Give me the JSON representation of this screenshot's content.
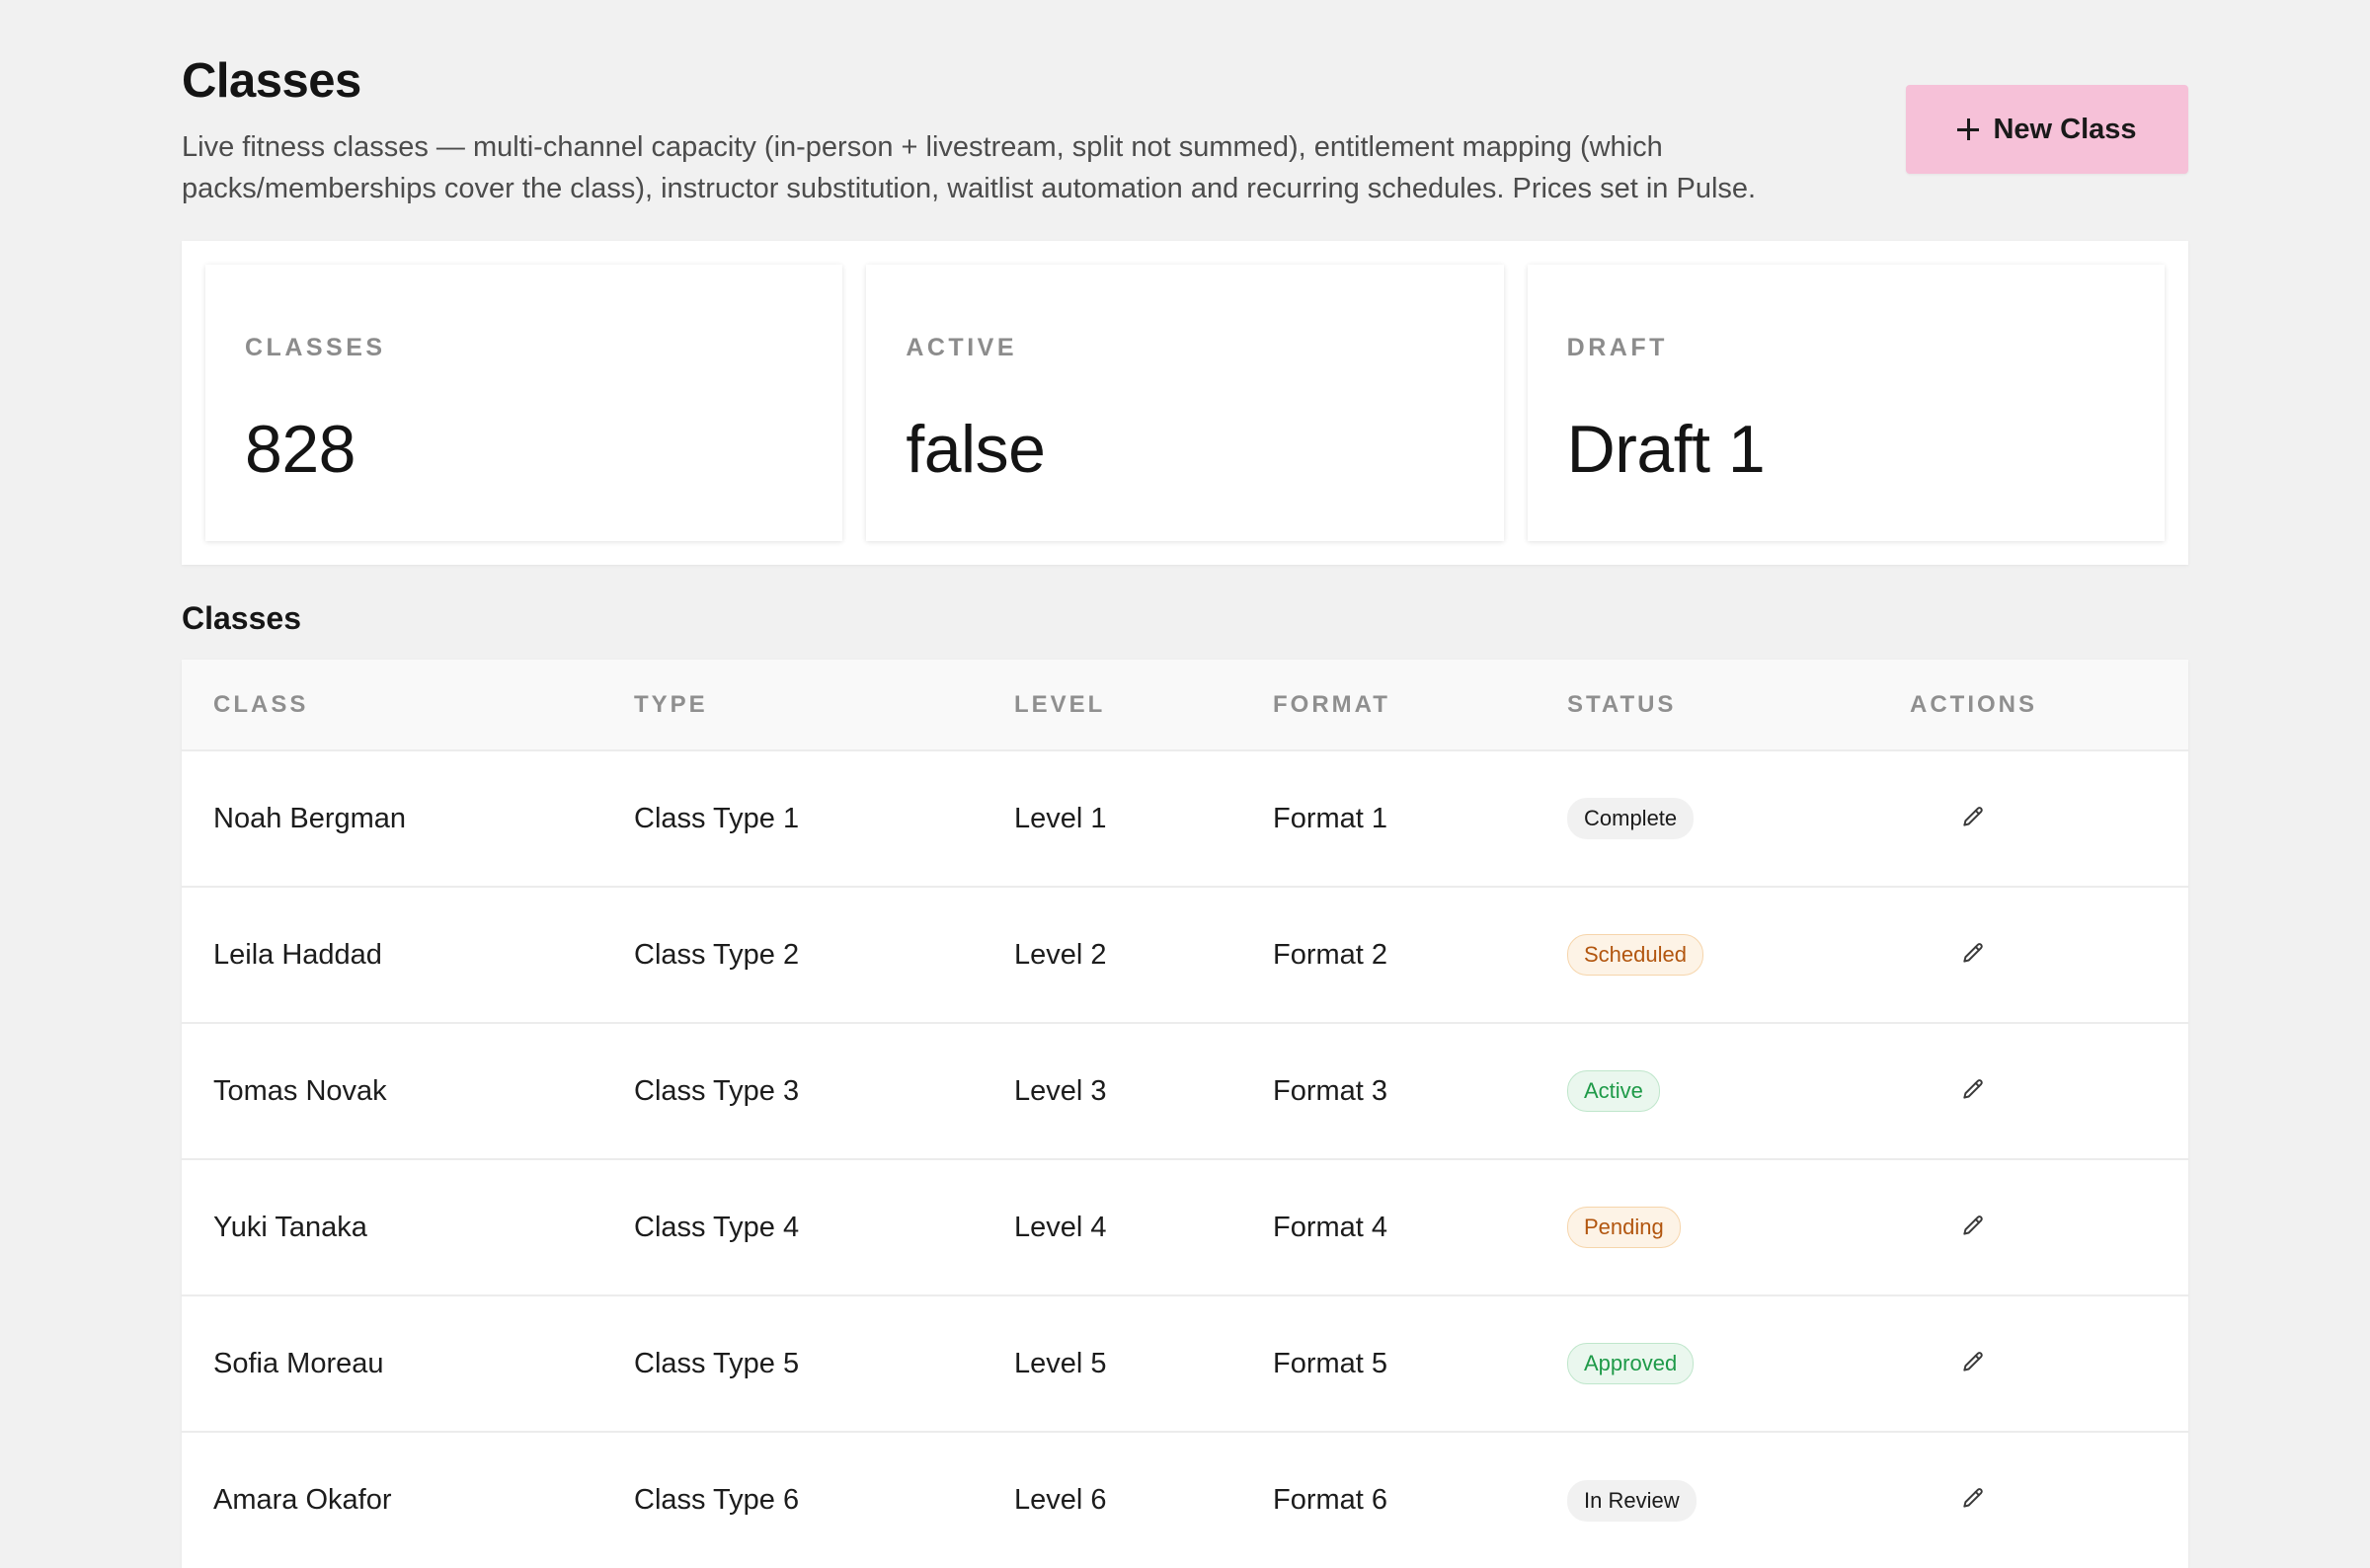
{
  "header": {
    "title": "Classes",
    "description": "Live fitness classes — multi-channel capacity (in-person + livestream, split not summed), entitlement mapping (which packs/memberships cover the class), instructor substitution, waitlist automation and recurring schedules. Prices set in Pulse.",
    "new_button_label": "New Class",
    "new_button_icon": "plus-icon",
    "accent_color": "#f6c1d8"
  },
  "stats": [
    {
      "label": "CLASSES",
      "value": "828"
    },
    {
      "label": "ACTIVE",
      "value": "false"
    },
    {
      "label": "DRAFT",
      "value": "Draft 1"
    }
  ],
  "table": {
    "title": "Classes",
    "columns": [
      "CLASS",
      "TYPE",
      "LEVEL",
      "FORMAT",
      "STATUS",
      "ACTIONS"
    ],
    "rows": [
      {
        "class": "Noah Bergman",
        "type": "Class Type 1",
        "level": "Level 1",
        "format": "Format 1",
        "status": "Complete",
        "status_kind": "neutral"
      },
      {
        "class": "Leila Haddad",
        "type": "Class Type 2",
        "level": "Level 2",
        "format": "Format 2",
        "status": "Scheduled",
        "status_kind": "warn"
      },
      {
        "class": "Tomas Novak",
        "type": "Class Type 3",
        "level": "Level 3",
        "format": "Format 3",
        "status": "Active",
        "status_kind": "success"
      },
      {
        "class": "Yuki Tanaka",
        "type": "Class Type 4",
        "level": "Level 4",
        "format": "Format 4",
        "status": "Pending",
        "status_kind": "warn"
      },
      {
        "class": "Sofia Moreau",
        "type": "Class Type 5",
        "level": "Level 5",
        "format": "Format 5",
        "status": "Approved",
        "status_kind": "success"
      },
      {
        "class": "Amara Okafor",
        "type": "Class Type 6",
        "level": "Level 6",
        "format": "Format 6",
        "status": "In Review",
        "status_kind": "neutral"
      }
    ],
    "row_action_icon": "pencil-edit-icon"
  }
}
